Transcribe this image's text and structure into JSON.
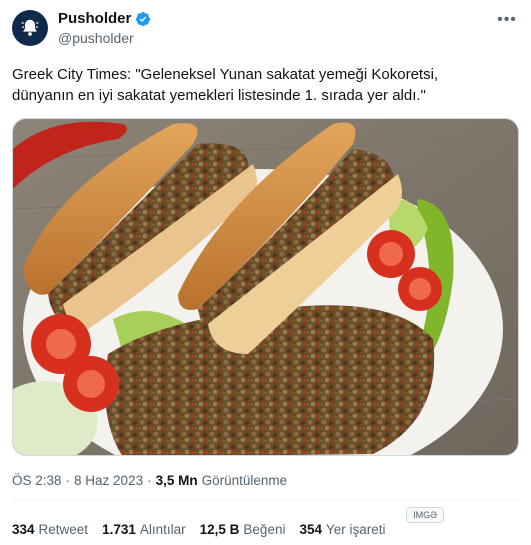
{
  "author": {
    "display_name": "Pusholder",
    "handle": "@pusholder",
    "verified_icon": "verified-badge-icon",
    "avatar_icon": "bell-icon"
  },
  "tweet": {
    "text_line1": "Greek City Times: \"Geleneksel Yunan sakatat yemeği Kokoretsi,",
    "text_line2": "dünyanın en iyi sakatat yemekleri listesinde 1. sırada yer aldı.\""
  },
  "media": {
    "alt": "Kokoretsi sandwiches with tomato and pepper"
  },
  "meta": {
    "time": "ÖS 2:38",
    "sep1": "·",
    "date": "8 Haz 2023",
    "sep2": "·",
    "views_count": "3,5 Mn",
    "views_label": "Görüntülenme"
  },
  "image_badge": "IMGƏ",
  "stats": {
    "retweets_count": "334",
    "retweets_label": "Retweet",
    "quotes_count": "1.731",
    "quotes_label": "Alıntılar",
    "likes_count": "12,5 B",
    "likes_label": "Beğeni",
    "bookmarks_count": "354",
    "bookmarks_label": "Yer işareti"
  },
  "colors": {
    "accent": "#1d9bf0",
    "secondary_text": "#536471",
    "avatar_bg": "#0f2a4a"
  }
}
